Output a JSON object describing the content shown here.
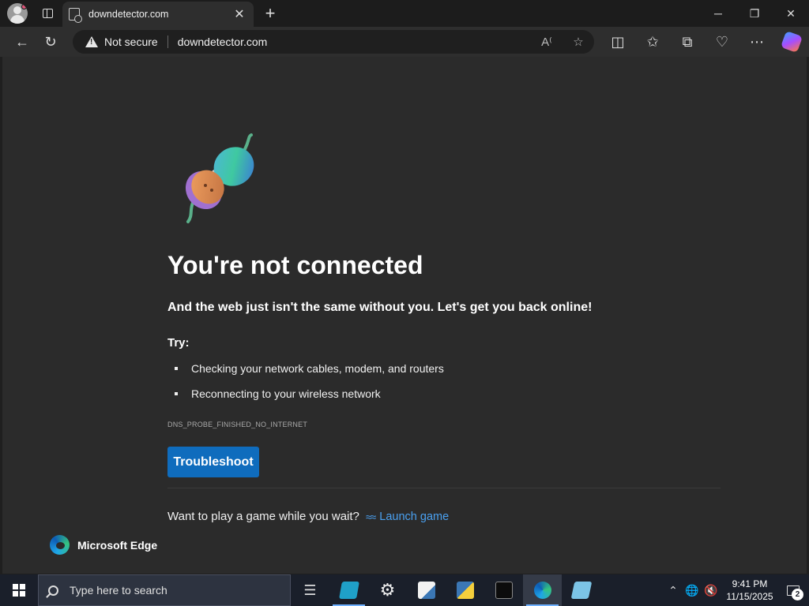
{
  "browser": {
    "tab": {
      "title": "downdetector.com",
      "close": "✕"
    },
    "new_tab": "+",
    "window_controls": {
      "minimize": "─",
      "restore": "❐",
      "close": "✕"
    },
    "address": {
      "security_label": "Not secure",
      "url": "downdetector.com"
    }
  },
  "error_page": {
    "heading": "You're not connected",
    "subheading": "And the web just isn't the same without you. Let's get you back online!",
    "try_label": "Try:",
    "tips": [
      "Checking your network cables, modem, and routers",
      "Reconnecting to your wireless network"
    ],
    "error_code": "DNS_PROBE_FINISHED_NO_INTERNET",
    "troubleshoot_label": "Troubleshoot",
    "game_prompt": "Want to play a game while you wait?",
    "launch_game_label": "Launch game",
    "brand": "Microsoft Edge"
  },
  "taskbar": {
    "search_placeholder": "Type here to search",
    "time": "9:41 PM",
    "date": "11/15/2025",
    "notification_count": "2"
  }
}
